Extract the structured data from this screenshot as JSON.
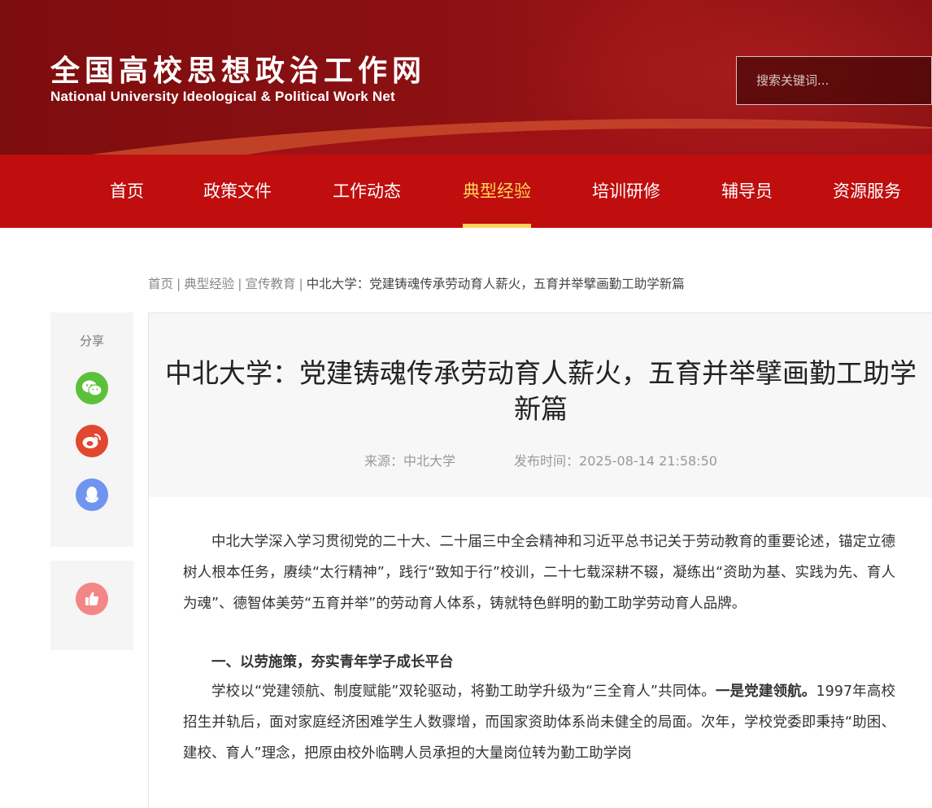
{
  "header": {
    "logo_cn": "全国高校思想政治工作网",
    "logo_en": "National University Ideological & Political Work Net",
    "search_placeholder": "搜索关键词..."
  },
  "nav": {
    "items": [
      "首页",
      "政策文件",
      "工作动态",
      "典型经验",
      "培训研修",
      "辅导员",
      "资源服务"
    ],
    "active": "典型经验"
  },
  "breadcrumb": {
    "items": [
      "首页",
      "典型经验",
      "宣传教育"
    ],
    "current": "中北大学：党建铸魂传承劳动育人薪火，五育并举擘画勤工助学新篇"
  },
  "share": {
    "label": "分享",
    "icons": [
      "wechat-icon",
      "weibo-icon",
      "qq-icon"
    ],
    "like_icon": "thumbs-up-icon"
  },
  "article": {
    "title": "中北大学：党建铸魂传承劳动育人薪火，五育并举擘画勤工助学新篇",
    "source": "来源：中北大学",
    "published": "发布时间：2025-08-14 21:58:50",
    "paragraph1": "中北大学深入学习贯彻党的二十大、二十届三中全会精神和习近平总书记关于劳动教育的重要论述，锚定立德树人根本任务，赓续“太行精神”，践行“致知于行”校训，二十七载深耕不辍，凝练出“资助为基、实践为先、育人为魂”、德智体美劳“五育并举”的劳动育人体系，铸就特色鲜明的勤工助学劳动育人品牌。",
    "section1_heading": "一、以劳施策，夯实青年学子成长平台",
    "paragraph2_a": "学校以“党建领航、制度赋能”双轮驱动，将勤工助学升级为“三全育人”共同体。",
    "paragraph2_bold": "一是党建领航。",
    "paragraph2_b": "1997年高校招生并轨后，面对家庭经济困难学生人数骤增，而国家资助体系尚未健全的局面。次年，学校党委即秉持“助困、建校、育人”理念，把原由校外临聘人员承担的大量岗位转为勤工助学岗"
  },
  "colors": {
    "header_dark": "#7e0d0f",
    "nav_red": "#c00d0e",
    "active_gold": "#ffd45a",
    "wechat": "#5cc13a",
    "weibo": "#e2472f",
    "qq": "#6f95f1",
    "like": "#f38686"
  }
}
